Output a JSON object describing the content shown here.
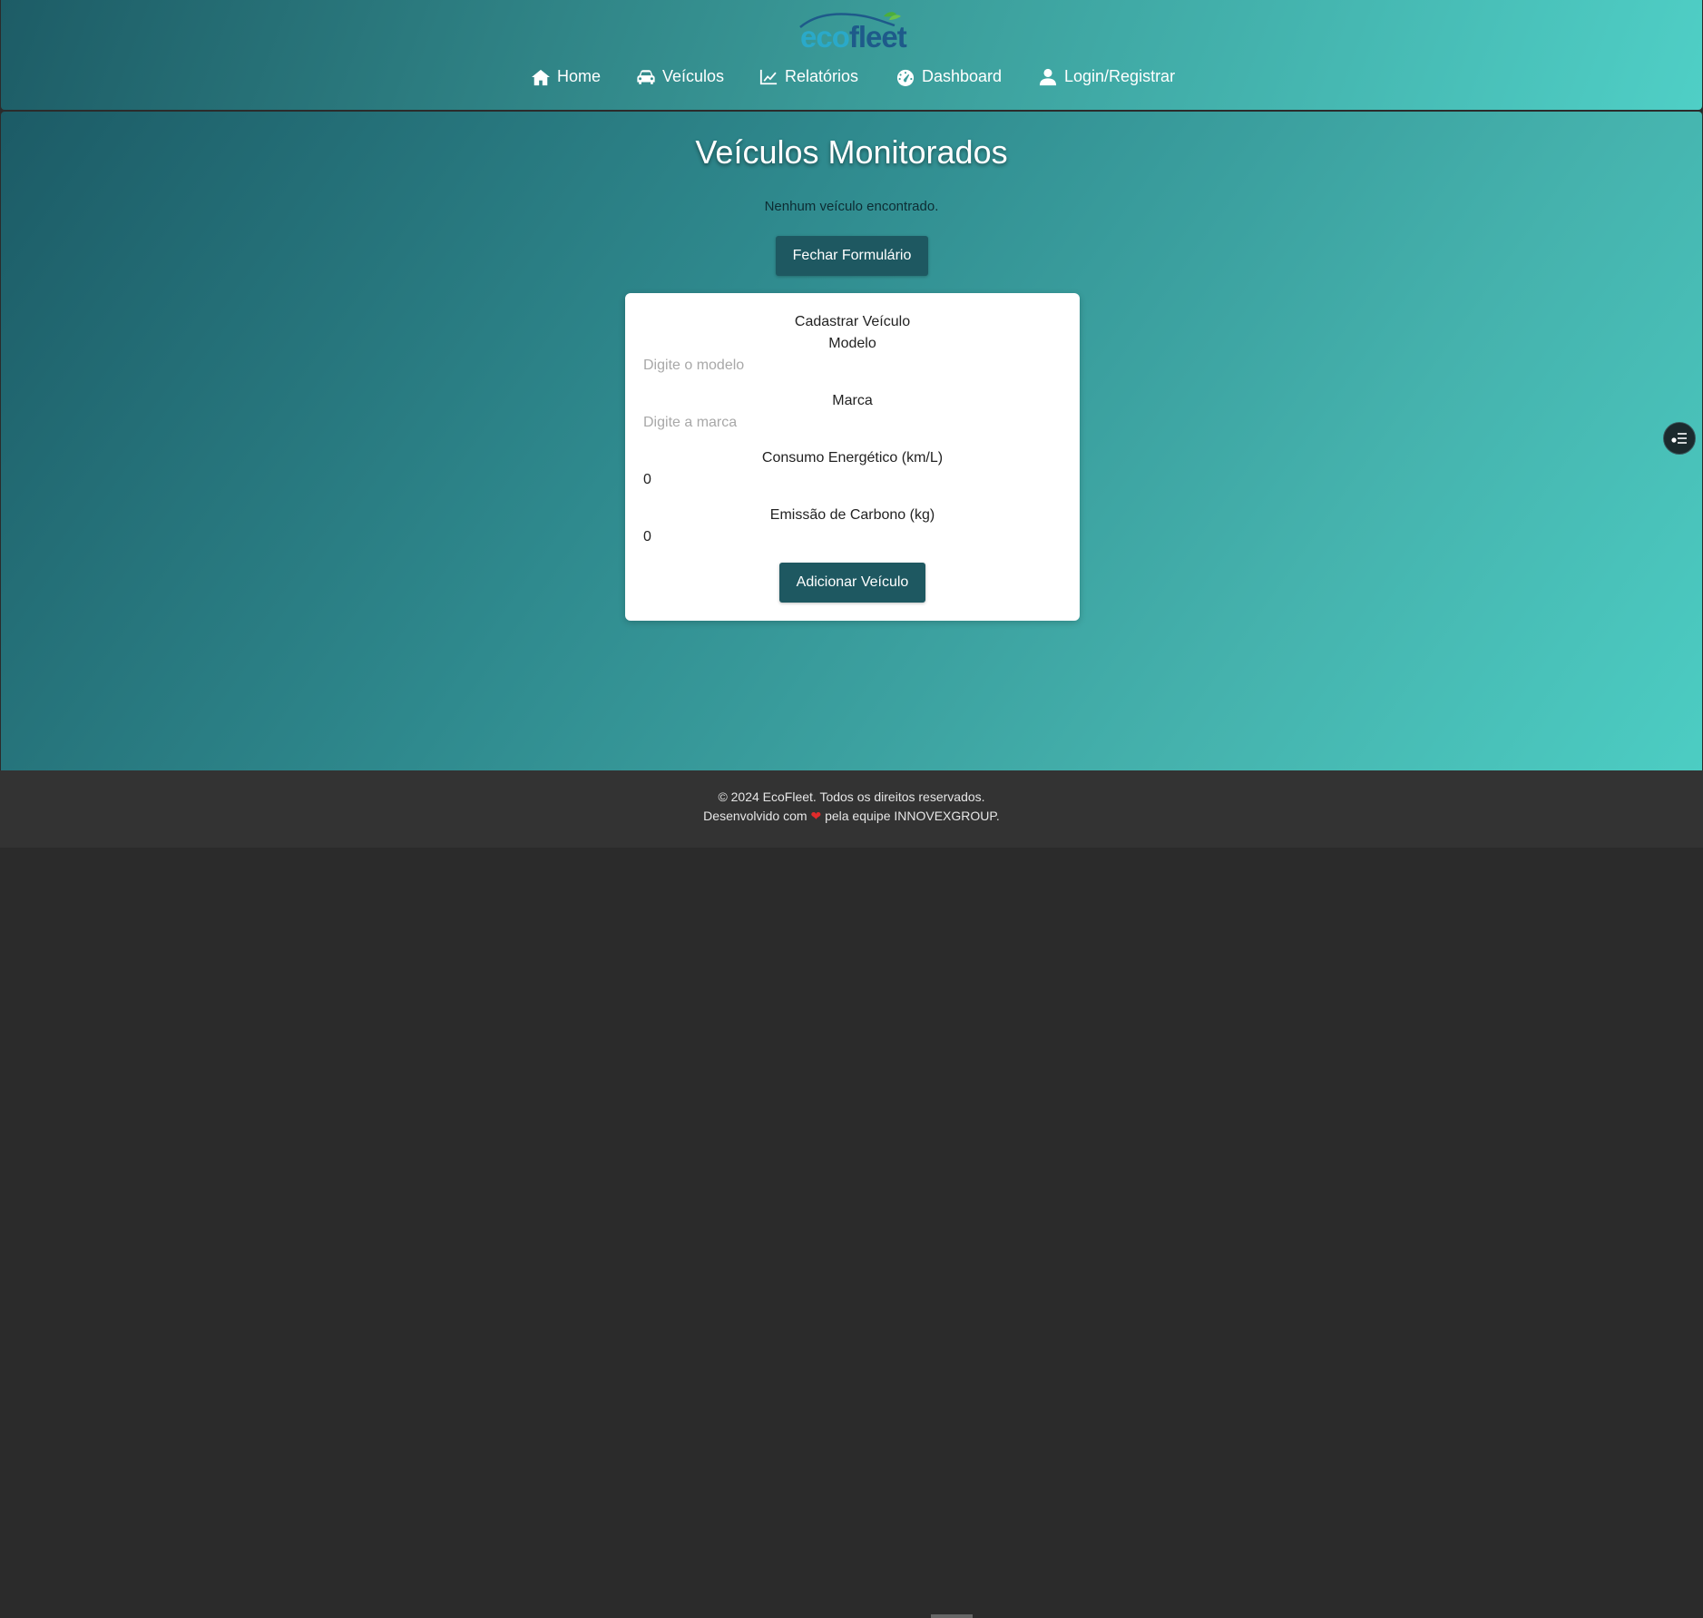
{
  "header": {
    "logo": {
      "part1": "eco",
      "part2": "fleet"
    },
    "nav": [
      {
        "label": "Home",
        "icon": "home-icon"
      },
      {
        "label": "Veículos",
        "icon": "car-icon"
      },
      {
        "label": "Relatórios",
        "icon": "chart-line-icon"
      },
      {
        "label": "Dashboard",
        "icon": "gauge-icon"
      },
      {
        "label": "Login/Registrar",
        "icon": "user-icon"
      }
    ]
  },
  "main": {
    "title": "Veículos Monitorados",
    "empty_message": "Nenhum veículo encontrado.",
    "close_form_label": "Fechar Formulário"
  },
  "form": {
    "title": "Cadastrar Veículo",
    "fields": [
      {
        "label": "Modelo",
        "placeholder": "Digite o modelo",
        "value": ""
      },
      {
        "label": "Marca",
        "placeholder": "Digite a marca",
        "value": ""
      },
      {
        "label": "Consumo Energético (km/L)",
        "placeholder": "",
        "value": "0"
      },
      {
        "label": "Emissão de Carbono (kg)",
        "placeholder": "",
        "value": "0"
      }
    ],
    "submit_label": "Adicionar Veículo"
  },
  "footer": {
    "copyright": "© 2024 EcoFleet. Todos os direitos reservados.",
    "dev_prefix": "Desenvolvido com",
    "heart": "❤",
    "dev_suffix": "pela equipe INNOVEXGROUP."
  },
  "colors": {
    "primary_button": "#1e5861",
    "header_start": "#1d5c66",
    "header_end": "#4fcfc6",
    "footer_bg": "#333333"
  }
}
